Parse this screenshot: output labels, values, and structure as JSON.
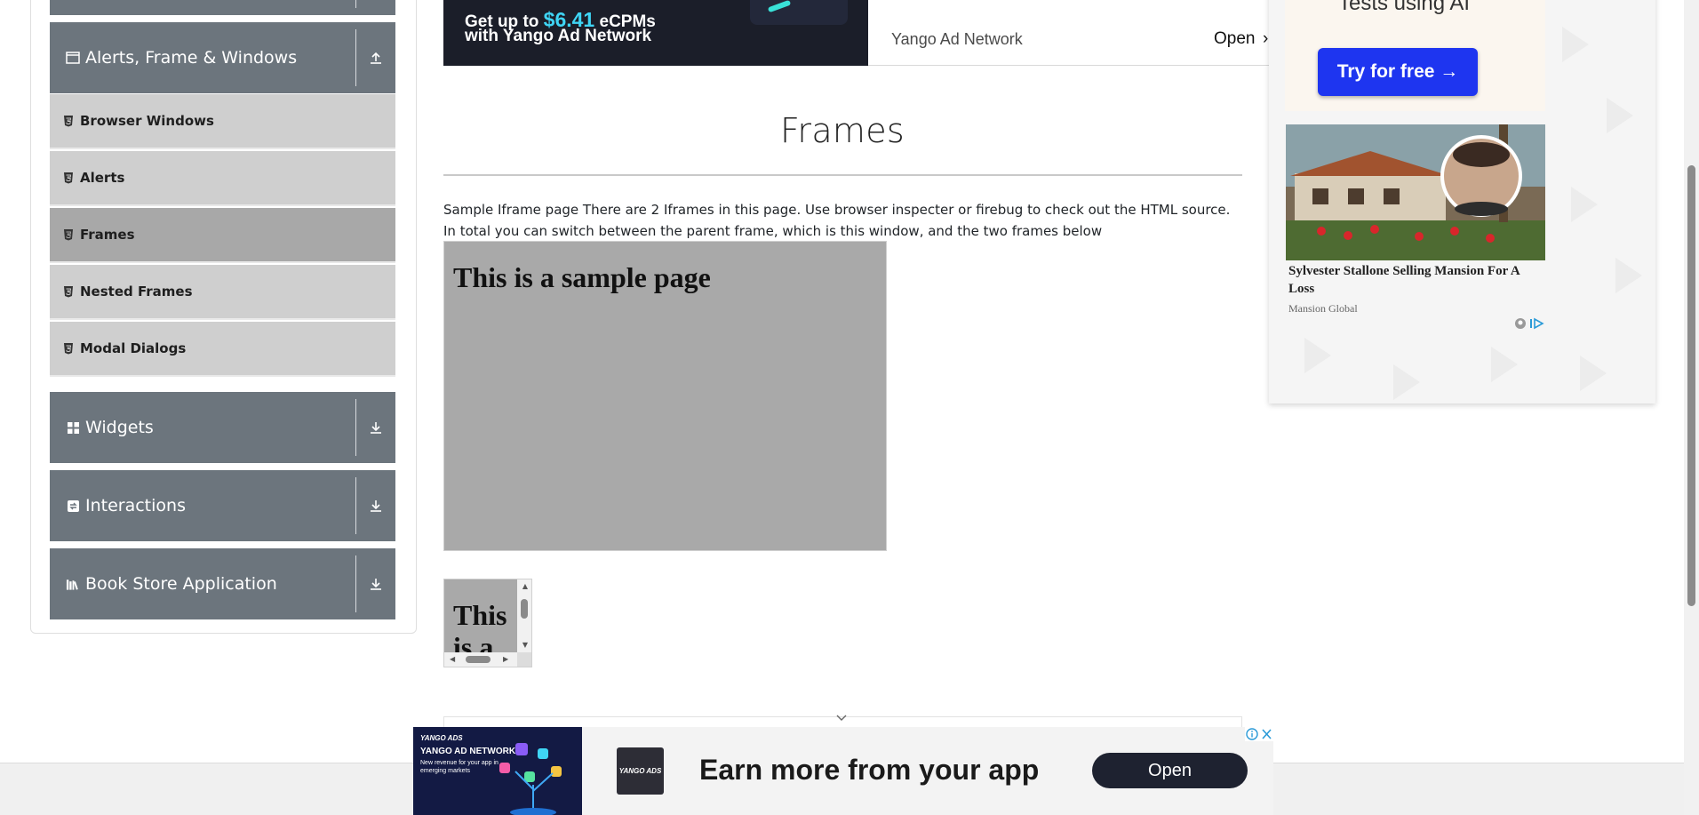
{
  "sidebar": {
    "groups": [
      {
        "label": "Alerts, Frame & Windows",
        "icon": "window-icon",
        "state": "expanded"
      },
      {
        "label": "Widgets",
        "icon": "grid-icon",
        "state": "collapsed"
      },
      {
        "label": "Interactions",
        "icon": "interactions-icon",
        "state": "collapsed"
      },
      {
        "label": "Book Store Application",
        "icon": "books-icon",
        "state": "collapsed"
      }
    ],
    "items": [
      {
        "label": "Browser Windows",
        "active": false
      },
      {
        "label": "Alerts",
        "active": false
      },
      {
        "label": "Frames",
        "active": true
      },
      {
        "label": "Nested Frames",
        "active": false
      },
      {
        "label": "Modal Dialogs",
        "active": false
      }
    ]
  },
  "top_ad": {
    "line1_prefix": "Get up to",
    "line1_highlight": "$6.41",
    "line1_suffix": "eCPMs",
    "line2": "with Yango Ad Network",
    "brand": "Yango Ad Network",
    "open": "Open",
    "chevron": "›"
  },
  "main": {
    "title": "Frames",
    "description": "Sample Iframe page There are 2 Iframes in this page. Use browser inspecter or firebug to check out the HTML source. In total you can switch between the parent frame, which is this window, and the two frames below",
    "frame1_heading": "This is a sample page",
    "frame2_heading": "This is a sample page"
  },
  "right_ad": {
    "headline": "Tests using AI",
    "button": "Try for free →",
    "caption": "Sylvester Stallone Selling Mansion For A Loss",
    "source": "Mansion Global"
  },
  "bottom_ad": {
    "image_brand": "YANGO ADS",
    "image_title": "YANGO AD NETWORK",
    "image_text": "New revenue for your app in emerging markets",
    "logo_text": "YANGO ADS",
    "headline": "Earn more from your app",
    "open": "Open"
  },
  "colors": {
    "sidebar_header": "#6c757d",
    "sidebar_item": "#cfcfcf",
    "sidebar_item_active": "#a8a8a8",
    "frame_bg": "#a9a9a9",
    "ad_button": "#1e35f0",
    "ad_highlight": "#3fd5f5"
  }
}
